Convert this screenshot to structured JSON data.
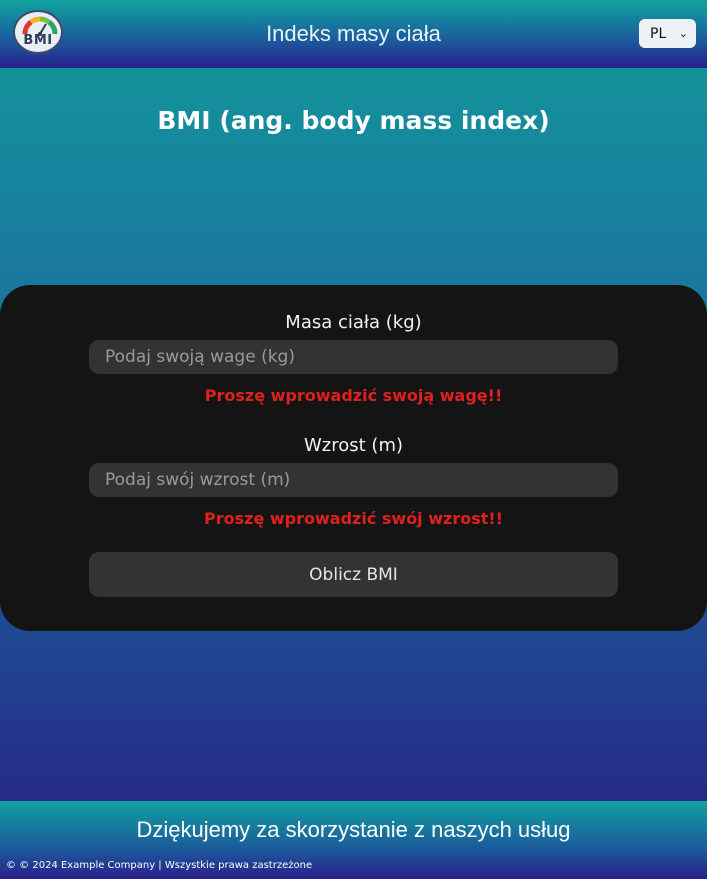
{
  "header": {
    "logo_text": "BMI",
    "title": "Indeks masy ciała",
    "language": {
      "selected": "PL"
    }
  },
  "main": {
    "title": "BMI (ang. body mass index)"
  },
  "form": {
    "weight": {
      "label": "Masa ciała (kg)",
      "placeholder": "Podaj swoją wage (kg)",
      "value": "",
      "error": "Proszę wprowadzić swoją wagę!!"
    },
    "height": {
      "label": "Wzrost (m)",
      "placeholder": "Podaj swój wzrost (m)",
      "value": "",
      "error": "Proszę wprowadzić swój wzrost!!"
    },
    "submit_label": "Oblicz BMI"
  },
  "footer": {
    "thanks": "Dziękujemy za skorzystanie z naszych usług",
    "copyright": "© © 2024 Example Company | Wszystkie prawa zastrzeżone"
  },
  "colors": {
    "error": "#e0201c",
    "card_bg": "#141414",
    "input_bg": "#333333"
  },
  "icons": [
    "bmi-gauge-icon",
    "chevron-down-icon"
  ]
}
